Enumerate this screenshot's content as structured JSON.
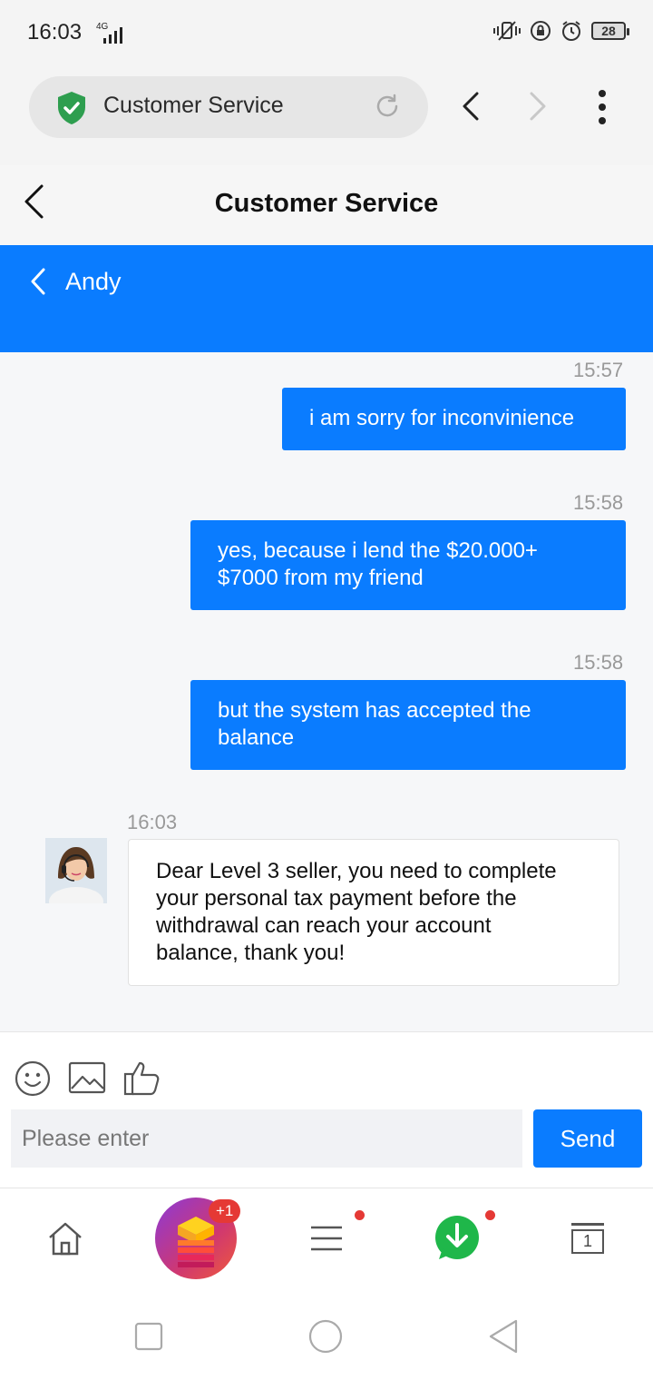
{
  "status_bar": {
    "time": "16:03",
    "network": "4G",
    "battery": "28"
  },
  "browser": {
    "url_title": "Customer Service"
  },
  "page": {
    "title": "Customer Service"
  },
  "agent": {
    "name": "Andy"
  },
  "messages": [
    {
      "direction": "outgoing",
      "time": "15:57",
      "lines": [
        "i am sorry for inconvinience"
      ]
    },
    {
      "direction": "outgoing",
      "time": "15:58",
      "lines": [
        "yes, because i lend the $20.000+",
        "$7000 from my friend"
      ]
    },
    {
      "direction": "outgoing",
      "time": "15:58",
      "lines": [
        "but the system has accepted the",
        "balance"
      ]
    },
    {
      "direction": "incoming",
      "time": "16:03",
      "lines": [
        "Dear Level 3 seller, you need to complete",
        "your personal tax payment before the",
        "withdrawal can reach your account",
        "balance, thank you!"
      ]
    }
  ],
  "composer": {
    "placeholder": "Please enter",
    "send_label": "Send"
  },
  "bottom_nav": {
    "games_badge": "+1",
    "tabs_count": "1"
  },
  "colors": {
    "accent": "#0a7cff",
    "badge": "#e53935",
    "whatsapp": "#1fb74a",
    "shield": "#2e9e4f"
  }
}
